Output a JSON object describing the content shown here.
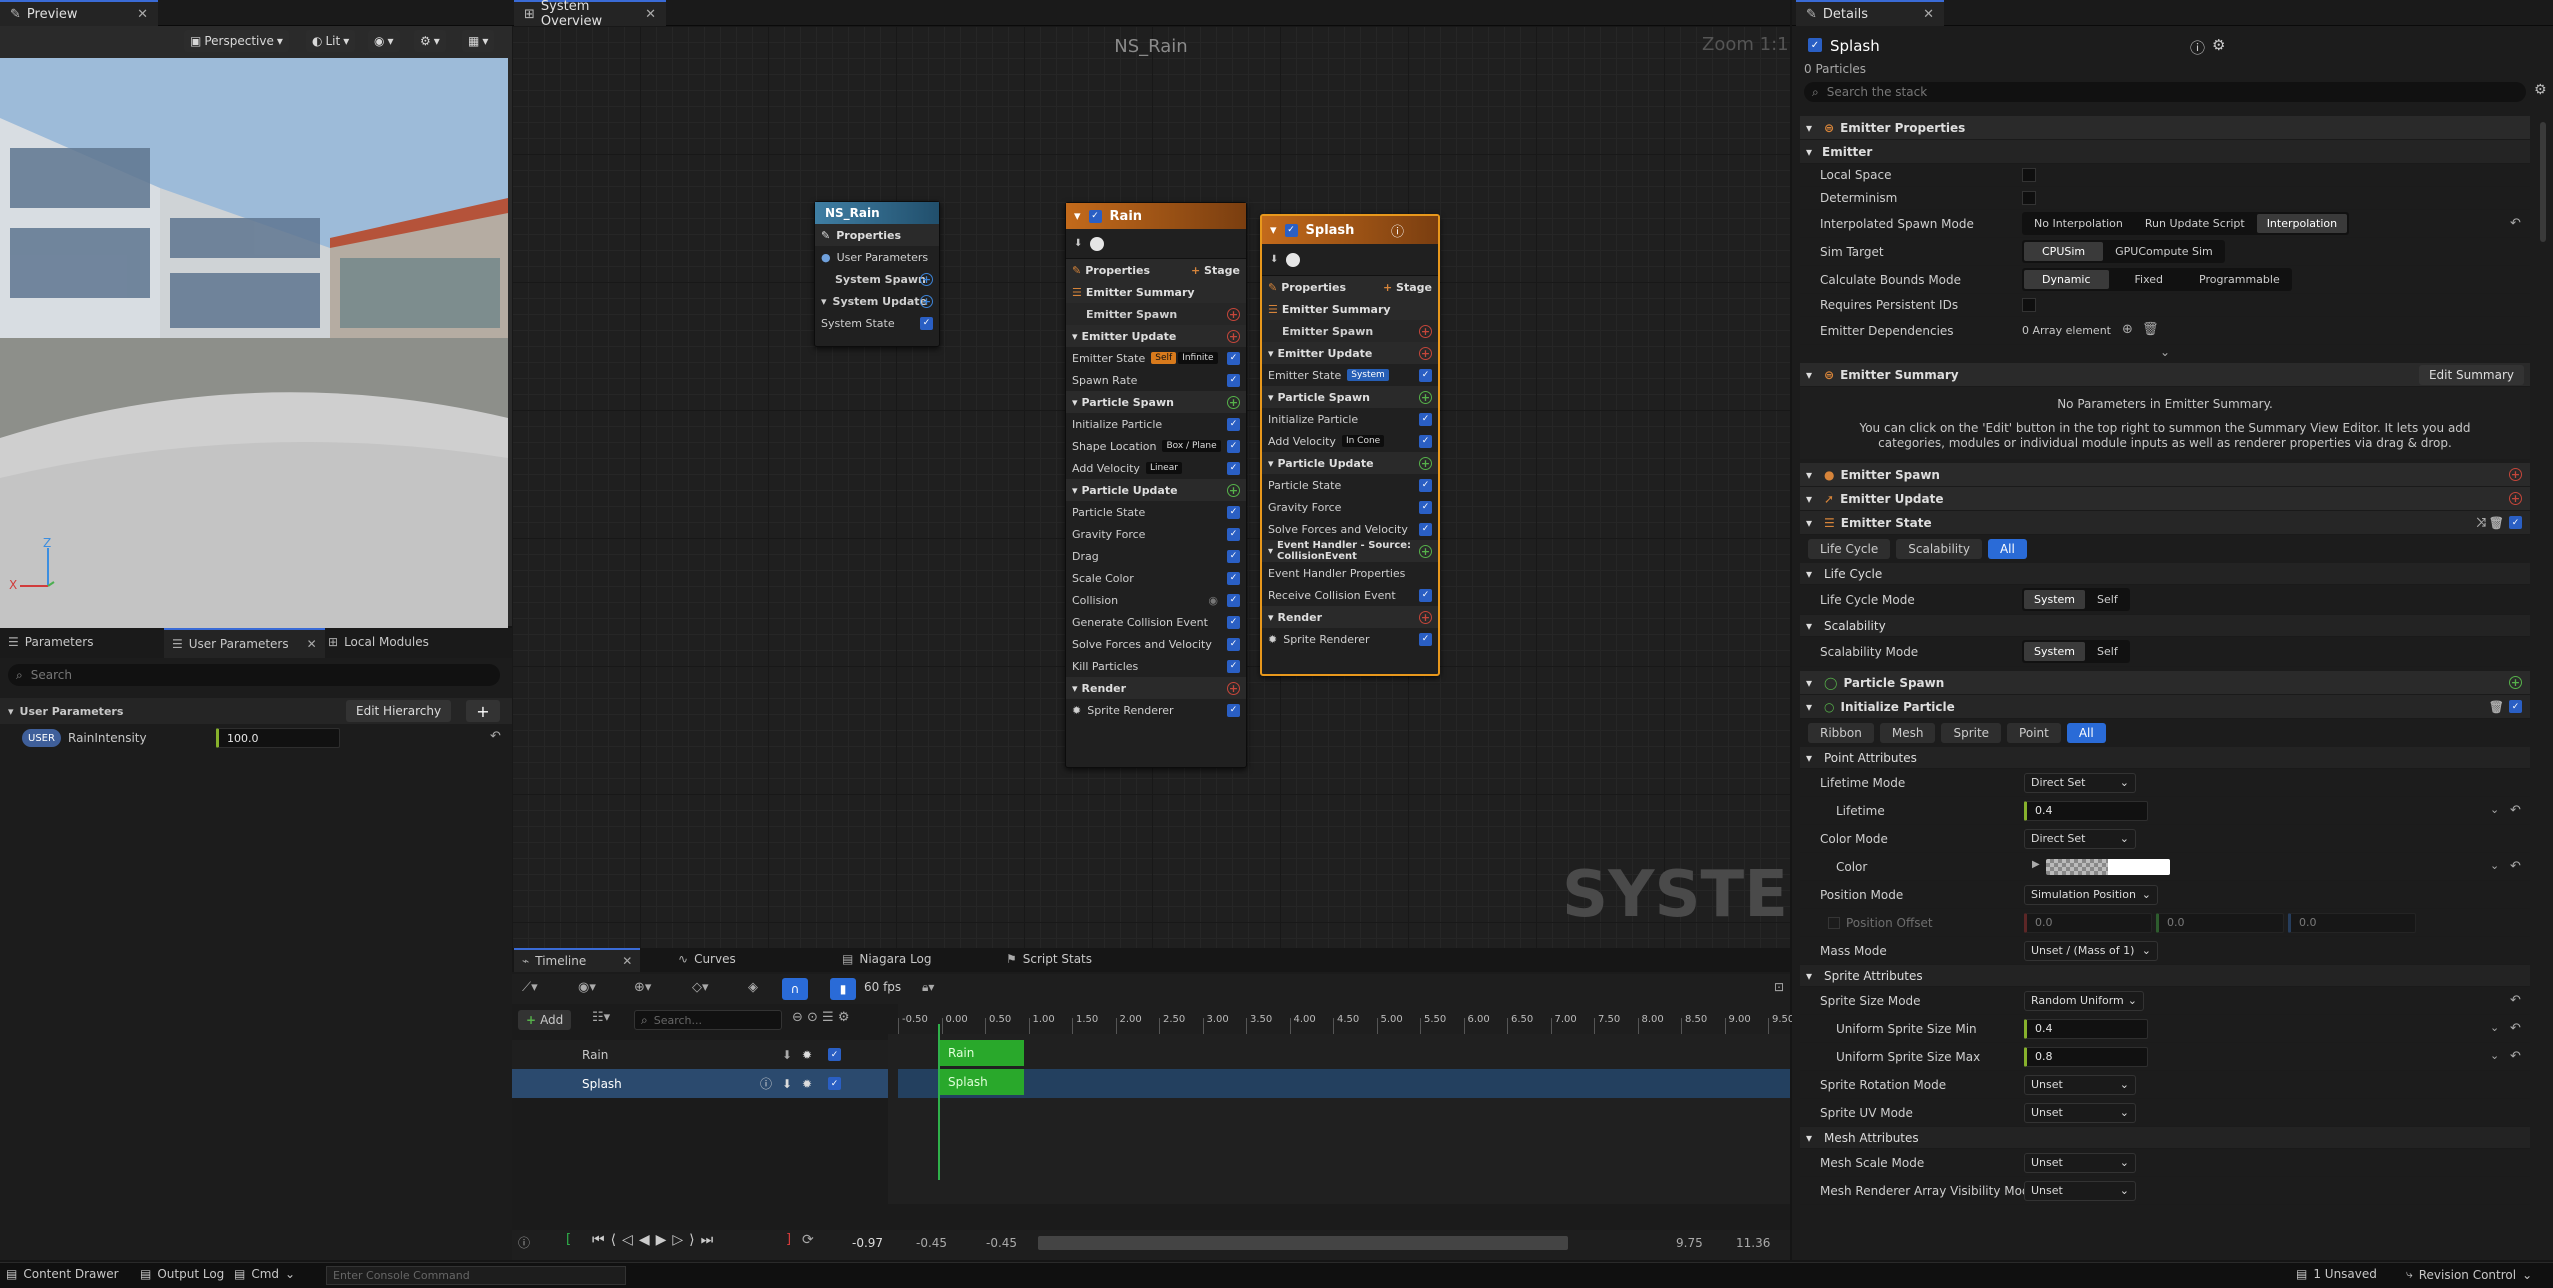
{
  "colors": {
    "accent": "#3a6bd6",
    "emitter_orange": "#d87a1c",
    "timeline_green": "#29a82b"
  },
  "preview": {
    "tab": "Preview",
    "toolbar": [
      "Perspective",
      "Lit"
    ],
    "axes": {
      "z": "Z",
      "x": "X"
    }
  },
  "params": {
    "tabs": [
      "Parameters",
      "User Parameters",
      "Local Modules"
    ],
    "search_placeholder": "Search",
    "section": "User Parameters",
    "edit_hierarchy": "Edit Hierarchy",
    "user_badge": "USER",
    "param_name": "RainIntensity",
    "param_value": "100.0"
  },
  "graph": {
    "tab": "System Overview",
    "title": "NS_Rain",
    "zoom": "Zoom 1:1",
    "watermark": "SYSTEM",
    "system_node": {
      "title": "NS_Rain",
      "rows": [
        "Properties",
        "User Parameters",
        "System Spawn",
        "System Update",
        "System State"
      ]
    },
    "rain": {
      "title": "Rain",
      "properties": "Properties",
      "stage": "Stage",
      "summary": "Emitter Summary",
      "emitter_spawn": "Emitter Spawn",
      "emitter_update": "Emitter Update",
      "emitter_state": "Emitter State",
      "tag_self": "Self",
      "tag_infinite": "Infinite",
      "spawn_rate": "Spawn Rate",
      "particle_spawn": "Particle Spawn",
      "init_particle": "Initialize Particle",
      "shape_location": "Shape Location",
      "tag_box": "Box / Plane",
      "add_velocity": "Add Velocity",
      "tag_linear": "Linear",
      "particle_update": "Particle Update",
      "particle_state": "Particle State",
      "gravity": "Gravity Force",
      "drag": "Drag",
      "scale_color": "Scale Color",
      "collision": "Collision",
      "gen_collision": "Generate Collision Event",
      "solve": "Solve Forces and Velocity",
      "kill": "Kill Particles",
      "render": "Render",
      "sprite": "Sprite Renderer"
    },
    "splash": {
      "title": "Splash",
      "properties": "Properties",
      "stage": "Stage",
      "summary": "Emitter Summary",
      "emitter_spawn": "Emitter Spawn",
      "emitter_update": "Emitter Update",
      "emitter_state": "Emitter State",
      "tag_system": "System",
      "particle_spawn": "Particle Spawn",
      "init_particle": "Initialize Particle",
      "add_velocity": "Add Velocity",
      "tag_cone": "In Cone",
      "particle_update": "Particle Update",
      "particle_state": "Particle State",
      "gravity": "Gravity Force",
      "solve": "Solve Forces and Velocity",
      "event_handler": "Event Handler - Source: CollisionEvent",
      "event_props": "Event Handler Properties",
      "receive": "Receive Collision Event",
      "render": "Render",
      "sprite": "Sprite Renderer"
    }
  },
  "timeline": {
    "tabs": [
      "Timeline",
      "Curves",
      "Niagara Log",
      "Script Stats"
    ],
    "add": "Add",
    "search_placeholder": "Search...",
    "fps": "60 fps",
    "tracks": [
      "Rain",
      "Splash"
    ],
    "ticks": [
      "-0.50",
      "0.00",
      "0.50",
      "1.00",
      "1.50",
      "2.00",
      "2.50",
      "3.00",
      "3.50",
      "4.00",
      "4.50",
      "5.00",
      "5.50",
      "6.00",
      "6.50",
      "7.00",
      "7.50",
      "8.00",
      "8.50",
      "9.00",
      "9.50"
    ],
    "current": "-0.97",
    "range_start": "-0.45",
    "range_start2": "-0.45",
    "range_end": "9.75",
    "range_end2": "11.36"
  },
  "details": {
    "tab": "Details",
    "emitter": "Splash",
    "particles": "0 Particles",
    "search_placeholder": "Search the stack",
    "emitter_properties": "Emitter Properties",
    "emitter_section": "Emitter",
    "local_space": "Local Space",
    "determinism": "Determinism",
    "interp_mode": "Interpolated Spawn Mode",
    "interp_opts": [
      "No Interpolation",
      "Run Update Script",
      "Interpolation"
    ],
    "sim_target": "Sim Target",
    "sim_opts": [
      "CPUSim",
      "GPUCompute Sim"
    ],
    "bounds_mode": "Calculate Bounds Mode",
    "bounds_opts": [
      "Dynamic",
      "Fixed",
      "Programmable"
    ],
    "persistent": "Requires Persistent IDs",
    "dependencies": "Emitter Dependencies",
    "array": "0 Array element",
    "summary": "Emitter Summary",
    "edit_summary": "Edit Summary",
    "no_params": "No Parameters in Emitter Summary.",
    "summary_help": "You can click on the 'Edit' button in the top right to summon the Summary View Editor. It lets you add categories, modules or individual module inputs as well as renderer properties via drag & drop.",
    "emitter_spawn": "Emitter Spawn",
    "emitter_update": "Emitter Update",
    "emitter_state": "Emitter State",
    "state_filters": [
      "Life Cycle",
      "Scalability",
      "All"
    ],
    "life_cycle": "Life Cycle",
    "life_cycle_mode": "Life Cycle Mode",
    "scalability": "Scalability",
    "scalability_mode": "Scalability Mode",
    "sys_self": [
      "System",
      "Self"
    ],
    "particle_spawn": "Particle Spawn",
    "init_particle": "Initialize Particle",
    "init_filters": [
      "Ribbon",
      "Mesh",
      "Sprite",
      "Point",
      "All"
    ],
    "point_attributes": "Point Attributes",
    "lifetime_mode": "Lifetime Mode",
    "direct_set": "Direct Set",
    "lifetime": "Lifetime",
    "lifetime_val": "0.4",
    "color_mode": "Color Mode",
    "color": "Color",
    "position_mode": "Position Mode",
    "position_val": "Simulation Position",
    "position_offset": "Position Offset",
    "offsets": [
      "0.0",
      "0.0",
      "0.0"
    ],
    "mass_mode": "Mass Mode",
    "mass_val": "Unset / (Mass of 1)",
    "sprite_attributes": "Sprite Attributes",
    "sprite_size_mode": "Sprite Size Mode",
    "random_uniform": "Random Uniform",
    "size_min": "Uniform Sprite Size Min",
    "size_min_val": "0.4",
    "size_max": "Uniform Sprite Size Max",
    "size_max_val": "0.8",
    "rotation_mode": "Sprite Rotation Mode",
    "uv_mode": "Sprite UV Mode",
    "unset": "Unset",
    "mesh_attributes": "Mesh Attributes",
    "mesh_scale": "Mesh Scale Mode",
    "mesh_vis": "Mesh Renderer Array Visibility Mode"
  },
  "status": {
    "content_drawer": "Content Drawer",
    "output_log": "Output Log",
    "cmd": "Cmd",
    "console_placeholder": "Enter Console Command",
    "unsaved": "1 Unsaved",
    "revision": "Revision Control"
  }
}
